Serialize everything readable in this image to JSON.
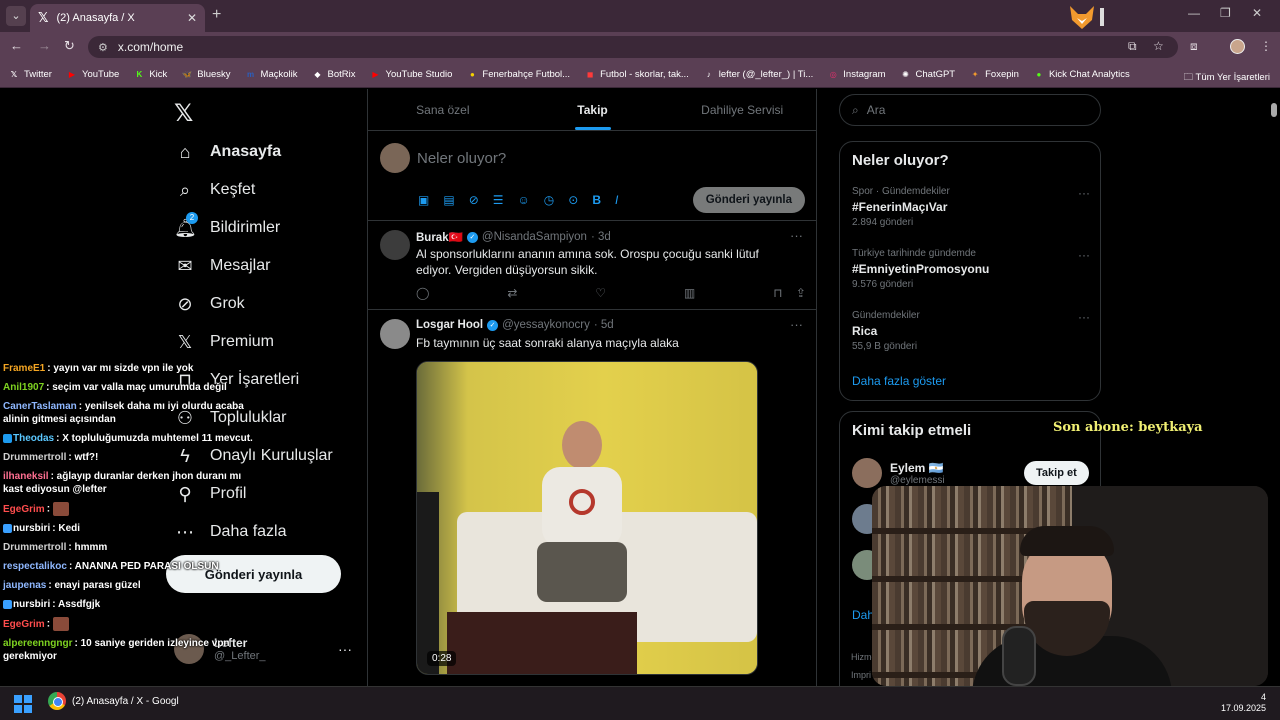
{
  "browser": {
    "tab_title": "(2) Anasayfa / X",
    "url": "x.com/home",
    "bookmarks": [
      {
        "label": "Twitter",
        "icon": "x-icon",
        "color": "#ffffff"
      },
      {
        "label": "YouTube",
        "icon": "youtube-icon",
        "color": "#ff0000"
      },
      {
        "label": "Kick",
        "icon": "kick-icon",
        "color": "#53fc18"
      },
      {
        "label": "Bluesky",
        "icon": "bluesky-icon",
        "color": "#1185fe"
      },
      {
        "label": "Maçkolik",
        "icon": "mackolik-icon",
        "color": "#2b5fbe"
      },
      {
        "label": "BotRix",
        "icon": "botrix-icon",
        "color": "#ffffff"
      },
      {
        "label": "YouTube Studio",
        "icon": "youtube-studio-icon",
        "color": "#ff0000"
      },
      {
        "label": "Fenerbahçe Futbol...",
        "icon": "fenerbahce-icon",
        "color": "#f5d100"
      },
      {
        "label": "Futbol - skorlar, tak...",
        "icon": "flashscore-icon",
        "color": "#ff3a3a"
      },
      {
        "label": "lefter (@_lefter_) | Ti...",
        "icon": "tiktok-icon",
        "color": "#ffffff"
      },
      {
        "label": "Instagram",
        "icon": "instagram-icon",
        "color": "#e1306c"
      },
      {
        "label": "ChatGPT",
        "icon": "chatgpt-icon",
        "color": "#ffffff"
      },
      {
        "label": "Foxepin",
        "icon": "foxepin-icon",
        "color": "#f29a2e"
      },
      {
        "label": "Kick Chat Analytics",
        "icon": "kick-analytics-icon",
        "color": "#53fc18"
      }
    ],
    "all_bookmarks": "Tüm Yer İşaretleri"
  },
  "nav": {
    "items": [
      {
        "label": "Anasayfa",
        "icon": "home-icon",
        "active": true
      },
      {
        "label": "Keşfet",
        "icon": "search-icon"
      },
      {
        "label": "Bildirimler",
        "icon": "bell-icon",
        "badge": "2"
      },
      {
        "label": "Mesajlar",
        "icon": "mail-icon"
      },
      {
        "label": "Grok",
        "icon": "grok-icon"
      },
      {
        "label": "Premium",
        "icon": "x-icon"
      },
      {
        "label": "Yer İşaretleri",
        "icon": "bookmark-icon"
      },
      {
        "label": "Topluluklar",
        "icon": "communities-icon"
      },
      {
        "label": "Onaylı Kuruluşlar",
        "icon": "lightning-icon"
      },
      {
        "label": "Profil",
        "icon": "person-icon"
      },
      {
        "label": "Daha fazla",
        "icon": "more-circle-icon"
      }
    ],
    "post_button": "Gönderi yayınla",
    "profile": {
      "name": "Lefter",
      "handle": "@_Lefter_"
    }
  },
  "timeline": {
    "tabs": [
      "Sana özel",
      "Takip",
      "Dahiliye Servisi"
    ],
    "active_tab": 1,
    "composer_placeholder": "Neler oluyor?",
    "composer_post": "Gönderi yayınla",
    "tweets": [
      {
        "name": "Burak🇹🇷",
        "handle": "@NisandaSampiyon",
        "time": "· 3d",
        "text": "Al sponsorluklarını ananın amına sok. Orospu çocuğu sanki lütuf ediyor. Vergiden düşüyorsun sikik."
      },
      {
        "name": "Losgar Hool",
        "handle": "@yessaykonocry",
        "time": "· 5d",
        "text": "Fb taymının üç saat sonraki alanya maçıyla alaka",
        "media_duration": "0:28"
      }
    ]
  },
  "right": {
    "search_placeholder": "Ara",
    "trends_title": "Neler oluyor?",
    "trends": [
      {
        "context": "Spor · Gündemdekiler",
        "tag": "#FenerinMaçıVar",
        "count": "2.894 gönderi"
      },
      {
        "context": "Türkiye tarihinde gündemde",
        "tag": "#EmniyetinPromosyonu",
        "count": "9.576 gönderi"
      },
      {
        "context": "Gündemdekiler",
        "tag": "Rica",
        "count": "55,9 B gönderi"
      }
    ],
    "show_more": "Daha fazla göster",
    "follow_title": "Kimi takip etmeli",
    "follow": {
      "name": "Eylem 🇦🇷",
      "handle": "@eylemessi",
      "button": "Takip et"
    },
    "follow_more_partial": "Daha",
    "footer_1": "Hizme",
    "footer_2": "Impri"
  },
  "overlay": {
    "sub_text": "Son abone: beytkaya",
    "chat": [
      {
        "user": "FrameE1",
        "color": "#f5a623",
        "text": ": yayın var mı sizde vpn ile yok"
      },
      {
        "user": "Anil1907",
        "color": "#7ed321",
        "text": ": seçim var valla maç umurumda değil"
      },
      {
        "user": "CanerTaslaman",
        "color": "#8fb8ff",
        "text": ": yenilsek daha mı iyi olurdu acaba alinin gitmesi açısından"
      },
      {
        "user": "Theodas",
        "color": "#5bc8ff",
        "text": ": X topluluğumuzda muhtemel 11 mevcut.",
        "badge": "#1d9bf0"
      },
      {
        "user": "Drummertroll",
        "color": "#cfcfcf",
        "text": ": wtf?!"
      },
      {
        "user": "ilhaneksil",
        "color": "#ff6f91",
        "text": ": ağlayıp duranlar derken jhon duranı mı kast ediyosun @lefter"
      },
      {
        "user": "EgeGrim",
        "color": "#ff4d4d",
        "text": ":",
        "emote": true
      },
      {
        "user": "nursbiri",
        "color": "#ffffff",
        "text": ": Kedi",
        "badge": "#3aa0ff"
      },
      {
        "user": "Drummertroll",
        "color": "#cfcfcf",
        "text": ": hmmm"
      },
      {
        "user": "respectalikoc",
        "color": "#8fb8ff",
        "text": ": ANANNA PED PARASI OLSUN"
      },
      {
        "user": "jaupenas",
        "color": "#8fb8ff",
        "text": ": enayi parası güzel"
      },
      {
        "user": "nursbiri",
        "color": "#ffffff",
        "text": ": Assdfgjk",
        "badge": "#3aa0ff"
      },
      {
        "user": "EgeGrim",
        "color": "#ff4d4d",
        "text": ":",
        "emote": true
      },
      {
        "user": "alpereenngngr",
        "color": "#7ed321",
        "text": ": 10 saniye geriden izleyince vpn gerekmiyor"
      }
    ]
  },
  "taskbar": {
    "app_title": "(2) Anasayfa / X - Googl",
    "time": "4",
    "date": "17.09.2025"
  }
}
